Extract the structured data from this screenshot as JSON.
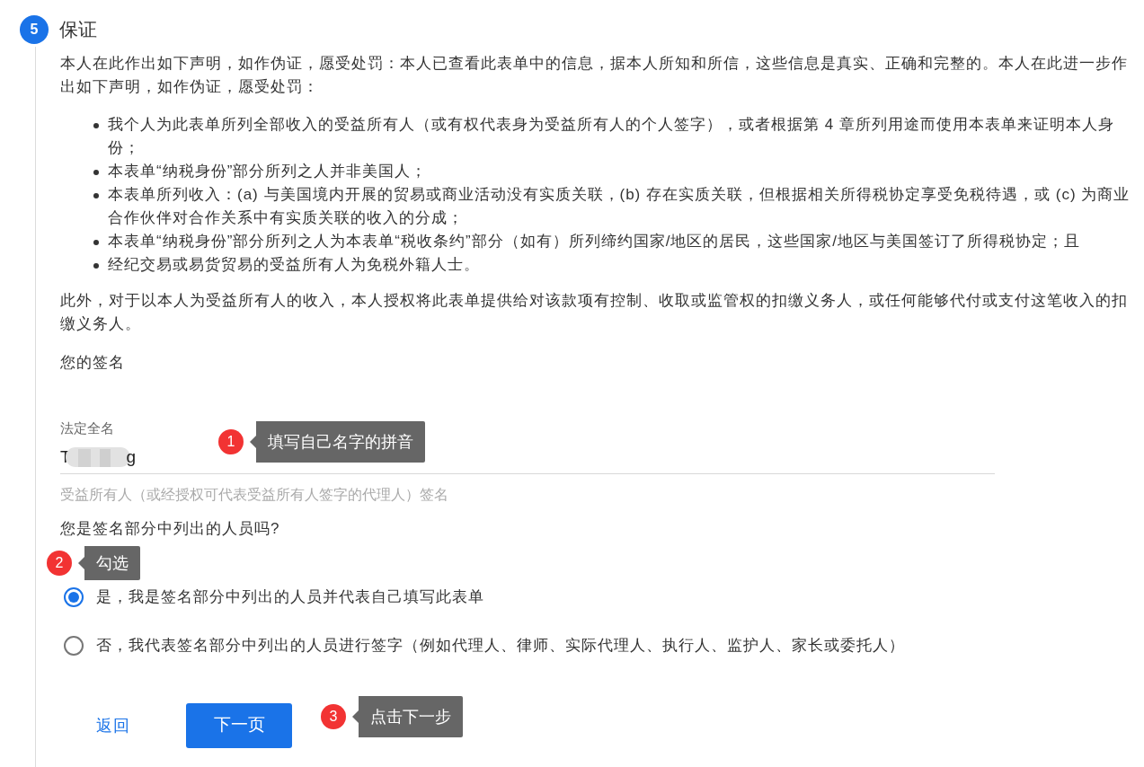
{
  "step": {
    "number": "5",
    "title": "保证"
  },
  "intro": "本人在此作出如下声明，如作伪证，愿受处罚：本人已查看此表单中的信息，据本人所知和所信，这些信息是真实、正确和完整的。本人在此进一步作出如下声明，如作伪证，愿受处罚：",
  "bullets": [
    "我个人为此表单所列全部收入的受益所有人（或有权代表身为受益所有人的个人签字），或者根据第 4 章所列用途而使用本表单来证明本人身份；",
    "本表单“纳税身份”部分所列之人并非美国人；",
    "本表单所列收入：(a) 与美国境内开展的贸易或商业活动没有实质关联，(b) 存在实质关联，但根据相关所得税协定享受免税待遇，或 (c) 为商业合作伙伴对合作关系中有实质关联的收入的分成；",
    "本表单“纳税身份”部分所列之人为本表单“税收条约”部分（如有）所列缔约国家/地区的居民，这些国家/地区与美国签订了所得税协定；且",
    "经纪交易或易货贸易的受益所有人为免税外籍人士。"
  ],
  "authorization": "此外，对于以本人为受益所有人的收入，本人授权将此表单提供给对该款项有控制、收取或监管权的扣缴义务人，或任何能够代付或支付这笔收入的扣缴义务人。",
  "signature_heading": "您的签名",
  "name_field": {
    "label": "法定全名",
    "value_start": "T",
    "value_end": "g",
    "redacted": true,
    "helper": "受益所有人（或经授权可代表受益所有人签字的代理人）签名"
  },
  "question": "您是签名部分中列出的人员吗?",
  "options": [
    {
      "label": "是，我是签名部分中列出的人员并代表自己填写此表单",
      "selected": true
    },
    {
      "label": "否，我代表签名部分中列出的人员进行签字（例如代理人、律师、实际代理人、执行人、监护人、家长或委托人）",
      "selected": false
    }
  ],
  "buttons": {
    "back": "返回",
    "next": "下一页"
  },
  "annotations": [
    {
      "number": "1",
      "text": "填写自己名字的拼音"
    },
    {
      "number": "2",
      "text": "勾选"
    },
    {
      "number": "3",
      "text": "点击下一步"
    }
  ]
}
